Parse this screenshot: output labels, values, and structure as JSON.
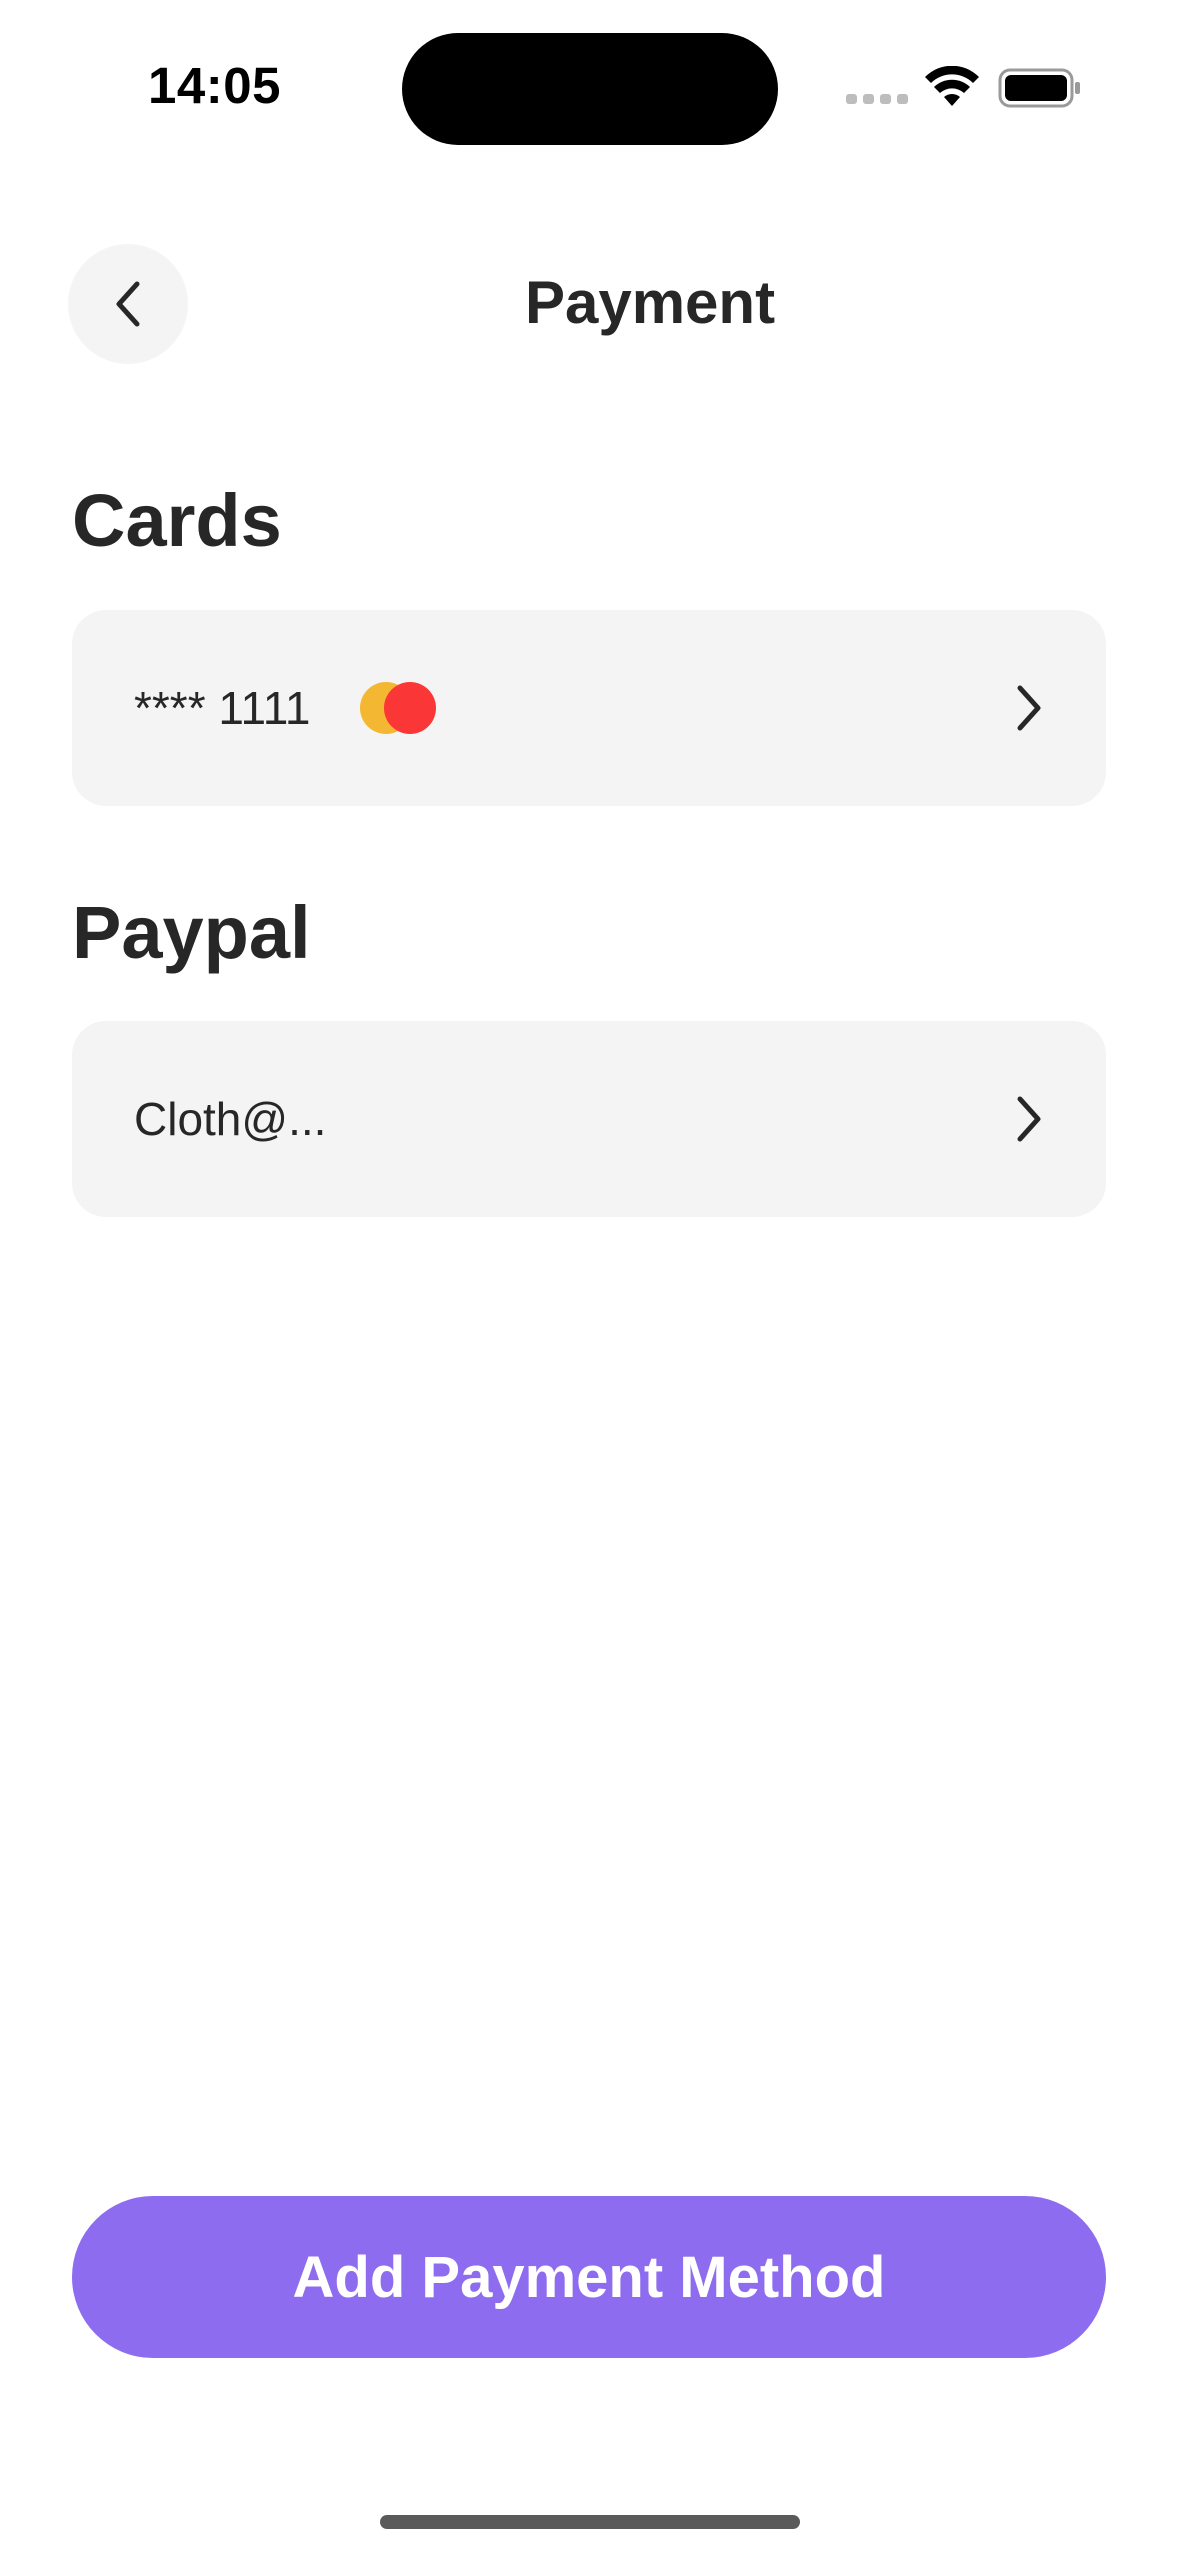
{
  "status_bar": {
    "time": "14:05"
  },
  "header": {
    "title": "Payment",
    "back_icon": "chevron-left-icon"
  },
  "cards_section": {
    "heading": "Cards",
    "items": [
      {
        "label": "**** 1111",
        "brand_icon": "mastercard-logo-icon"
      }
    ]
  },
  "paypal_section": {
    "heading": "Paypal",
    "items": [
      {
        "label": "Cloth@..."
      }
    ]
  },
  "actions": {
    "add_payment_label": "Add Payment Method"
  },
  "colors": {
    "accent": "#8E6CEF",
    "row_background": "#F4F4F4",
    "text": "#272727",
    "mastercard_yellow": "#F4B731",
    "mastercard_red": "#FA3636"
  }
}
